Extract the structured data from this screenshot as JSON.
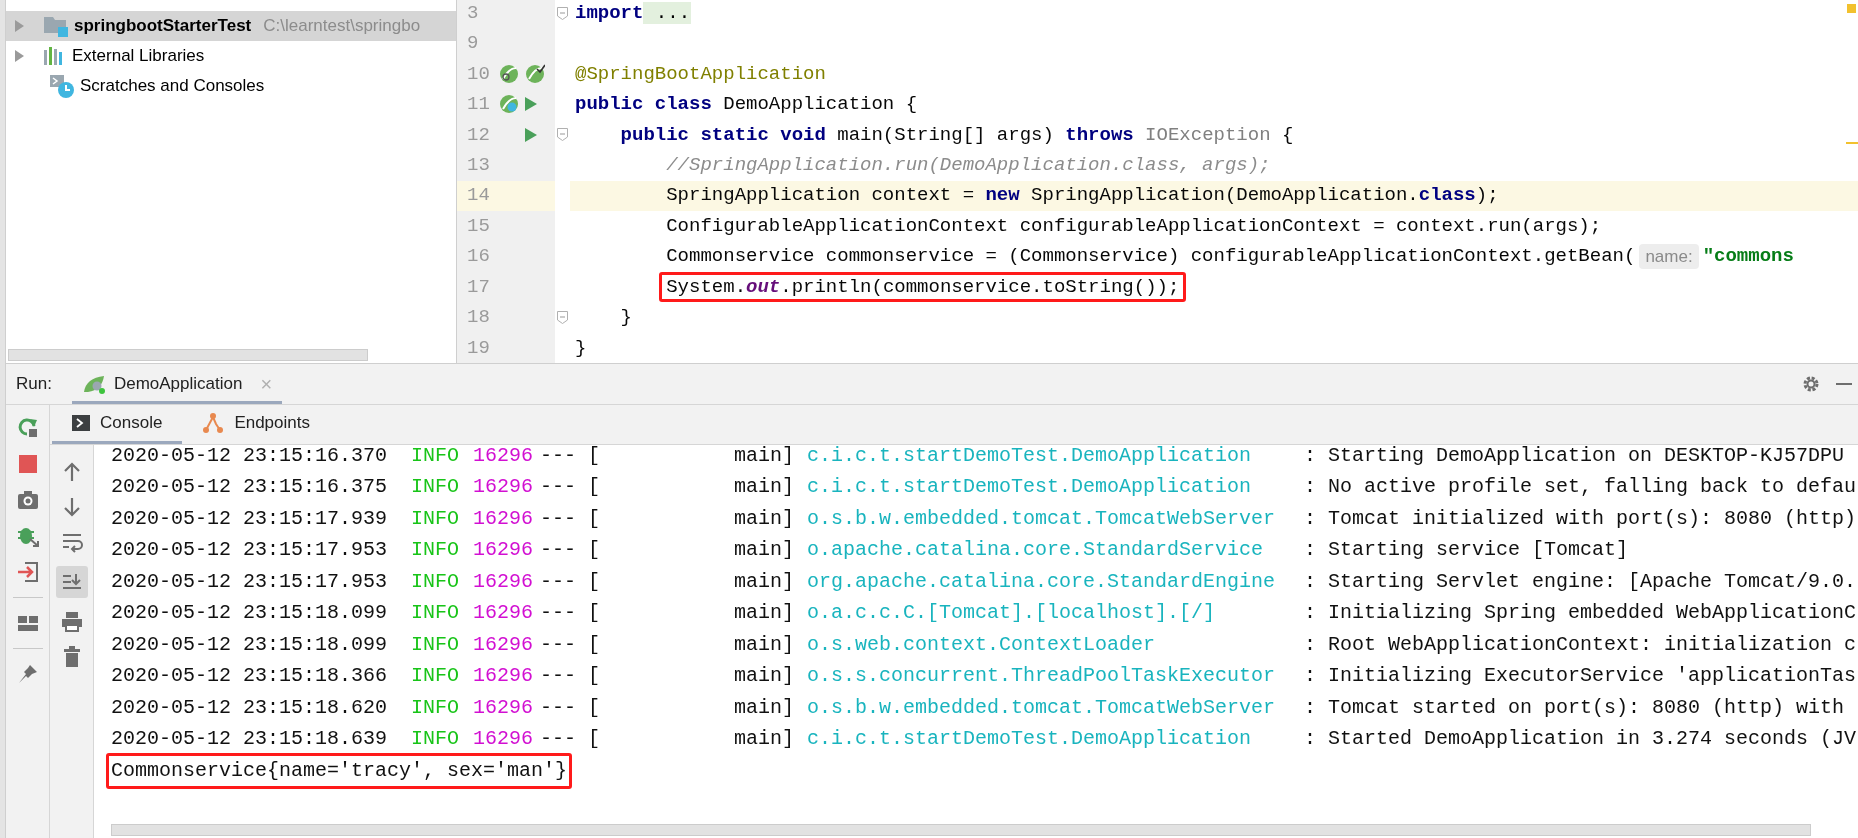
{
  "project_tree": [
    {
      "label": "springbootStarterTest",
      "path": "C:\\learntest\\springbo",
      "has_children": true,
      "selected": true
    },
    {
      "label": "External Libraries",
      "has_children": true,
      "selected": false
    },
    {
      "label": "Scratches and Consoles",
      "has_children": false,
      "selected": false
    }
  ],
  "editor": {
    "lines": [
      {
        "number": "3",
        "current": false,
        "boxed": false,
        "tokens": [
          {
            "text": "import",
            "kind": "kw"
          },
          {
            "text": " ...",
            "kind": "fold"
          }
        ]
      },
      {
        "number": "9",
        "current": false,
        "boxed": false
      },
      {
        "number": "10",
        "current": false,
        "boxed": false,
        "tokens": [
          {
            "text": "@SpringBootApplication",
            "kind": "ann"
          }
        ]
      },
      {
        "number": "11",
        "current": false,
        "boxed": false,
        "tokens": [
          {
            "text": "public class",
            "kind": "kw"
          },
          {
            "text": " DemoApplication {",
            "kind": "plain"
          }
        ]
      },
      {
        "number": "12",
        "current": false,
        "boxed": false,
        "tokens": [
          {
            "text": "    public static void",
            "kind": "kw"
          },
          {
            "text": " main(String[] args) ",
            "kind": "plain"
          },
          {
            "text": "throws",
            "kind": "kw"
          },
          {
            "text": " IOException",
            "kind": "dim"
          },
          {
            "text": " {",
            "kind": "plain"
          }
        ]
      },
      {
        "number": "13",
        "current": false,
        "boxed": false,
        "tokens": [
          {
            "text": "        //SpringApplication.run(DemoApplication.class, args);",
            "kind": "cmt"
          }
        ]
      },
      {
        "number": "14",
        "current": true,
        "boxed": false,
        "tokens": [
          {
            "text": "        SpringApplication context = ",
            "kind": "plain"
          },
          {
            "text": "new",
            "kind": "kw"
          },
          {
            "text": " SpringApplication(DemoApplication.",
            "kind": "plain"
          },
          {
            "text": "class",
            "kind": "kw"
          },
          {
            "text": ");",
            "kind": "plain"
          }
        ]
      },
      {
        "number": "15",
        "current": false,
        "boxed": false,
        "tokens": [
          {
            "text": "        ConfigurableApplicationContext configurableApplicationContext = context.run(args);",
            "kind": "plain"
          }
        ]
      },
      {
        "number": "16",
        "current": false,
        "boxed": false,
        "tokens": [
          {
            "text": "        Commonservice commonservice = (Commonservice) configurableApplicationContext.getBean(",
            "kind": "plain"
          },
          {
            "text": "name:",
            "kind": "hint"
          },
          {
            "text": "\"commons",
            "kind": "str"
          }
        ]
      },
      {
        "number": "17",
        "current": false,
        "boxed": true,
        "tokens": [
          {
            "text": "        System.",
            "kind": "plain"
          },
          {
            "text": "out",
            "kind": "fld"
          },
          {
            "text": ".println(commonservice.toString());",
            "kind": "plain"
          }
        ]
      },
      {
        "number": "18",
        "current": false,
        "boxed": false,
        "tokens": [
          {
            "text": "    }",
            "kind": "plain"
          }
        ]
      },
      {
        "number": "19",
        "current": false,
        "boxed": false,
        "tokens": [
          {
            "text": "}",
            "kind": "plain"
          }
        ]
      }
    ]
  },
  "run_panel": {
    "label": "Run:",
    "tab": {
      "label": "DemoApplication",
      "close": "×"
    },
    "tabs": [
      {
        "label": "Console",
        "selected": true
      },
      {
        "label": "Endpoints",
        "selected": false
      }
    ],
    "console": [
      {
        "kind": "log",
        "time": "2020-05-12 23:15:16.370",
        "level": "INFO",
        "pid": "16296",
        "sep": "--- [",
        "thread": "main]",
        "logger": "c.i.c.t.startDemoTest.DemoApplication",
        "message": ": Starting DemoApplication on DESKTOP-KJ57DPU"
      },
      {
        "kind": "log",
        "time": "2020-05-12 23:15:16.375",
        "level": "INFO",
        "pid": "16296",
        "sep": "--- [",
        "thread": "main]",
        "logger": "c.i.c.t.startDemoTest.DemoApplication",
        "message": ": No active profile set, falling back to defau"
      },
      {
        "kind": "log",
        "time": "2020-05-12 23:15:17.939",
        "level": "INFO",
        "pid": "16296",
        "sep": "--- [",
        "thread": "main]",
        "logger": "o.s.b.w.embedded.tomcat.TomcatWebServer",
        "message": ": Tomcat initialized with port(s): 8080 (http)"
      },
      {
        "kind": "log",
        "time": "2020-05-12 23:15:17.953",
        "level": "INFO",
        "pid": "16296",
        "sep": "--- [",
        "thread": "main]",
        "logger": "o.apache.catalina.core.StandardService",
        "message": ": Starting service [Tomcat]"
      },
      {
        "kind": "log",
        "time": "2020-05-12 23:15:17.953",
        "level": "INFO",
        "pid": "16296",
        "sep": "--- [",
        "thread": "main]",
        "logger": "org.apache.catalina.core.StandardEngine",
        "message": ": Starting Servlet engine: [Apache Tomcat/9.0."
      },
      {
        "kind": "log",
        "time": "2020-05-12 23:15:18.099",
        "level": "INFO",
        "pid": "16296",
        "sep": "--- [",
        "thread": "main]",
        "logger": "o.a.c.c.C.[Tomcat].[localhost].[/]",
        "message": ": Initializing Spring embedded WebApplicationC"
      },
      {
        "kind": "log",
        "time": "2020-05-12 23:15:18.099",
        "level": "INFO",
        "pid": "16296",
        "sep": "--- [",
        "thread": "main]",
        "logger": "o.s.web.context.ContextLoader",
        "message": ": Root WebApplicationContext: initialization c"
      },
      {
        "kind": "log",
        "time": "2020-05-12 23:15:18.366",
        "level": "INFO",
        "pid": "16296",
        "sep": "--- [",
        "thread": "main]",
        "logger": "o.s.s.concurrent.ThreadPoolTaskExecutor",
        "message": ": Initializing ExecutorService 'applicationTas"
      },
      {
        "kind": "log",
        "time": "2020-05-12 23:15:18.620",
        "level": "INFO",
        "pid": "16296",
        "sep": "--- [",
        "thread": "main]",
        "logger": "o.s.b.w.embedded.tomcat.TomcatWebServer",
        "message": ": Tomcat started on port(s): 8080 (http) with"
      },
      {
        "kind": "log",
        "time": "2020-05-12 23:15:18.639",
        "level": "INFO",
        "pid": "16296",
        "sep": "--- [",
        "thread": "main]",
        "logger": "c.i.c.t.startDemoTest.DemoApplication",
        "message": ": Started DemoApplication in 3.274 seconds (JV"
      },
      {
        "kind": "output",
        "text": "Commonservice{name='tracy', sex='man'}",
        "boxed": true
      }
    ]
  }
}
